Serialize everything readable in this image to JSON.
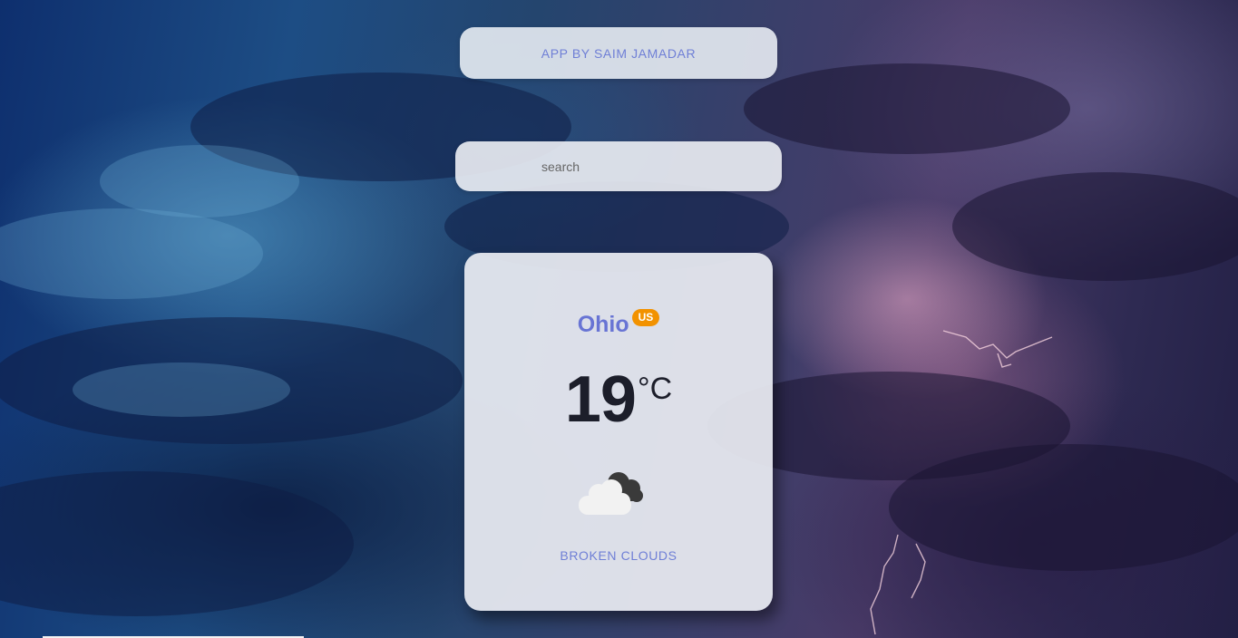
{
  "credit": {
    "text": "APP BY SAIM JAMADAR"
  },
  "search": {
    "placeholder": "search",
    "value": ""
  },
  "weather": {
    "city": "Ohio",
    "country": "US",
    "temperature": "19",
    "unit": "°C",
    "condition": "BROKEN CLOUDS",
    "icon": "broken-clouds-icon"
  },
  "colors": {
    "accent": "#6f7fd6",
    "badge": "#f29200",
    "temperature": "#1c1e2a"
  }
}
